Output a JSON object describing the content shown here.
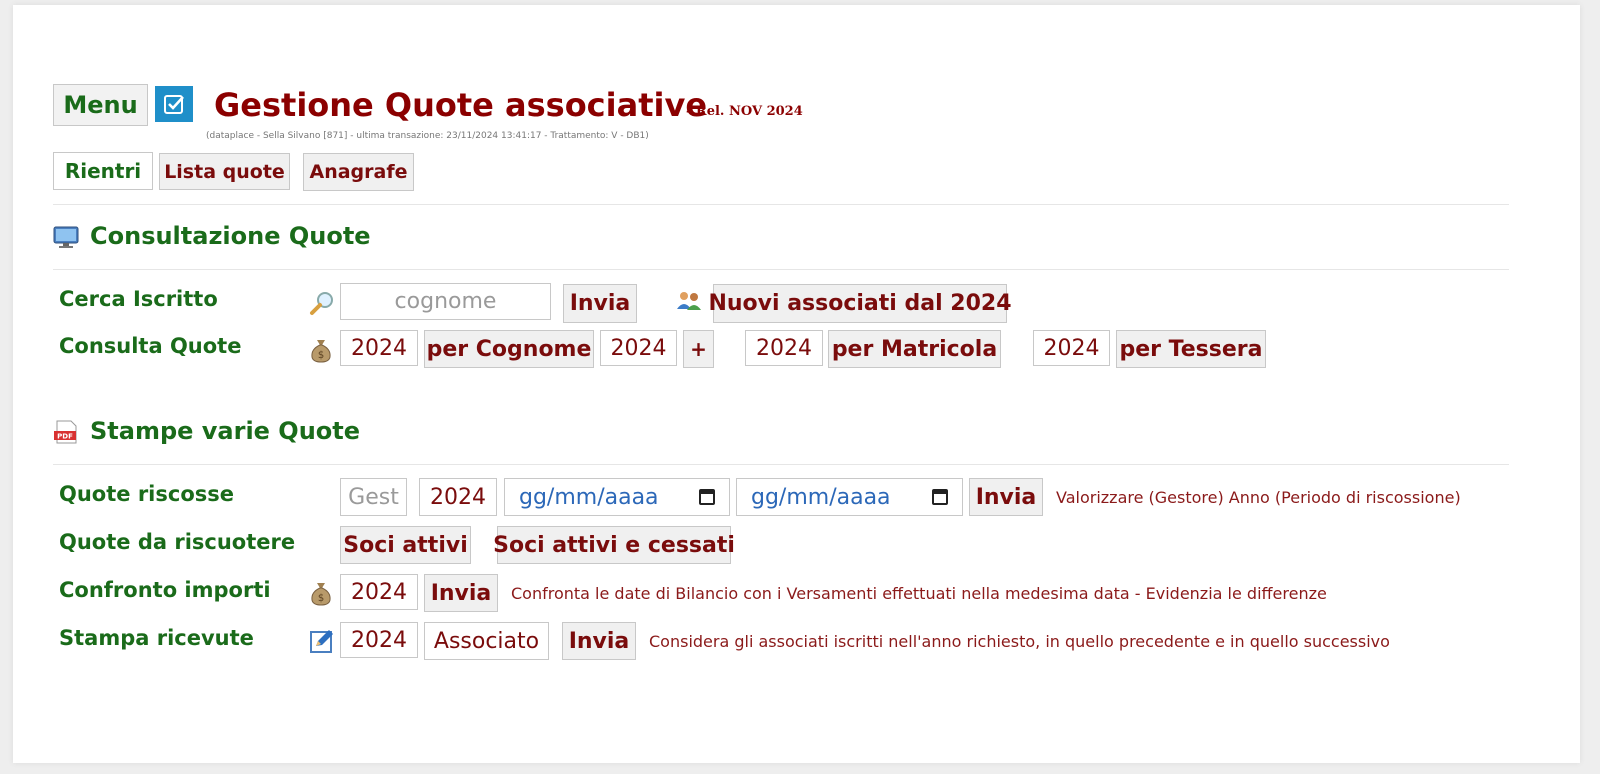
{
  "header": {
    "menu_label": "Menu",
    "title": "Gestione Quote associative",
    "release": "- Rel. NOV 2024",
    "meta": "(dataplace - Sella Silvano [871] - ultima transazione: 23/11/2024 13:41:17 - Trattamento: V - DB1)"
  },
  "nav": {
    "rientri": "Rientri",
    "lista_quote": "Lista quote",
    "anagrafe": "Anagrafe"
  },
  "consultazione": {
    "title": "Consultazione Quote",
    "cerca": {
      "label": "Cerca Iscritto",
      "placeholder": "cognome",
      "invia": "Invia",
      "nuovi": "Nuovi associati dal 2024"
    },
    "consulta": {
      "label": "Consulta Quote",
      "year1": "2024",
      "per_cognome": "per Cognome",
      "year2": "2024",
      "plus": "+",
      "year3": "2024",
      "per_matricola": "per Matricola",
      "year4": "2024",
      "per_tessera": "per Tessera"
    }
  },
  "stampe": {
    "title": "Stampe varie Quote",
    "riscosse": {
      "label": "Quote riscosse",
      "gest_placeholder": "Gest",
      "year": "2024",
      "date_from": "gg/mm/aaaa",
      "date_to": "gg/mm/aaaa",
      "invia": "Invia",
      "note": "Valorizzare (Gestore) Anno (Periodo di riscossione)"
    },
    "da_riscuotere": {
      "label": "Quote da riscuotere",
      "soci_attivi": "Soci attivi",
      "soci_attivi_cessati": "Soci attivi e cessati"
    },
    "confronto": {
      "label": "Confronto importi",
      "year": "2024",
      "invia": "Invia",
      "note": "Confronta le date di Bilancio con i Versamenti effettuati nella medesima data - Evidenzia le differenze"
    },
    "ricevute": {
      "label": "Stampa ricevute",
      "year": "2024",
      "associato": "Associato",
      "invia": "Invia",
      "note": "Considera gli associati iscritti nell'anno richiesto, in quello precedente e in quello successivo"
    }
  },
  "colors": {
    "title_red": "#8b0000",
    "label_green": "#1a6b1a",
    "button_text": "#7a0c0c",
    "accent_blue": "#1f8fc9"
  }
}
